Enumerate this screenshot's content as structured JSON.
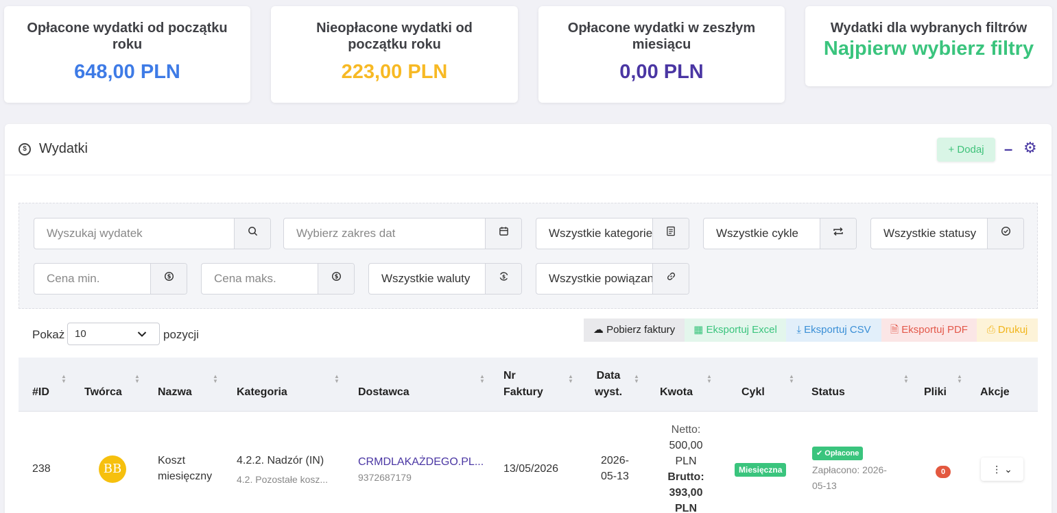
{
  "cards": [
    {
      "title": "Opłacone wydatki od początku roku",
      "value": "648,00 PLN",
      "color": "#3e7be6"
    },
    {
      "title": "Nieopłacone wydatki od początku roku",
      "value": "223,00 PLN",
      "color": "#f7b924"
    },
    {
      "title": "Opłacone wydatki w zeszłym miesiącu",
      "value": "0,00 PLN",
      "color": "#4a36a3"
    },
    {
      "title": "Wydatki dla wybranych filtrów",
      "value": "Najpierw wybierz filtry",
      "color": "#3ac47d"
    }
  ],
  "panel": {
    "title": "Wydatki",
    "add_label": "+ Dodaj",
    "minimize_label": "–",
    "settings_icon": "gear-icon",
    "icon": "dollar-circle-icon"
  },
  "filters": {
    "search_placeholder": "Wyszukaj wydatek",
    "date_placeholder": "Wybierz zakres dat",
    "category_value": "Wszystkie kategorie",
    "cycle_value": "Wszystkie cykle",
    "status_value": "Wszystkie statusy",
    "price_min_placeholder": "Cena min.",
    "price_max_placeholder": "Cena maks.",
    "currency_value": "Wszystkie waluty",
    "links_value": "Wszystkie powiązania"
  },
  "length": {
    "prefix": "Pokaż",
    "value": "10",
    "suffix": "pozycji"
  },
  "export": {
    "invoices": "Pobierz faktury",
    "excel": "Eksportuj Excel",
    "csv": "Eksportuj CSV",
    "pdf": "Eksportuj PDF",
    "print": "Drukuj"
  },
  "table": {
    "headers": {
      "id": "#ID",
      "creator": "Twórca",
      "name": "Nazwa",
      "category": "Kategoria",
      "supplier": "Dostawca",
      "invoice_l1": "Nr",
      "invoice_l2": "Faktury",
      "date_l1": "Data",
      "date_l2": "wyst.",
      "amount": "Kwota",
      "cycle": "Cykl",
      "status": "Status",
      "files": "Pliki",
      "actions": "Akcje"
    },
    "row": {
      "id": "238",
      "creator_initials": "BB",
      "name_l1": "Koszt",
      "name_l2": "miesięczny",
      "category": "4.2.2. Nadzór (IN)",
      "category_sub": "4.2. Pozostałe kosz...",
      "supplier": "CRMDLAKAŻDEGO.PL...",
      "supplier_nip": "9372687179",
      "invoice": "13/05/2026",
      "date_l1": "2026-",
      "date_l2": "05-13",
      "netto_label": "Netto:",
      "netto_l1": "500,00",
      "netto_l2": "PLN",
      "brutto_label": "Brutto:",
      "brutto_l1": "393,00",
      "brutto_l2": "PLN",
      "cycle": "Miesięczna",
      "status_badge": "✔ Opłacone",
      "paid_l1": "Zapłacono: 2026-",
      "paid_l2": "05-13",
      "files_count": "0",
      "actions_label": "⋮  ⌄"
    }
  }
}
